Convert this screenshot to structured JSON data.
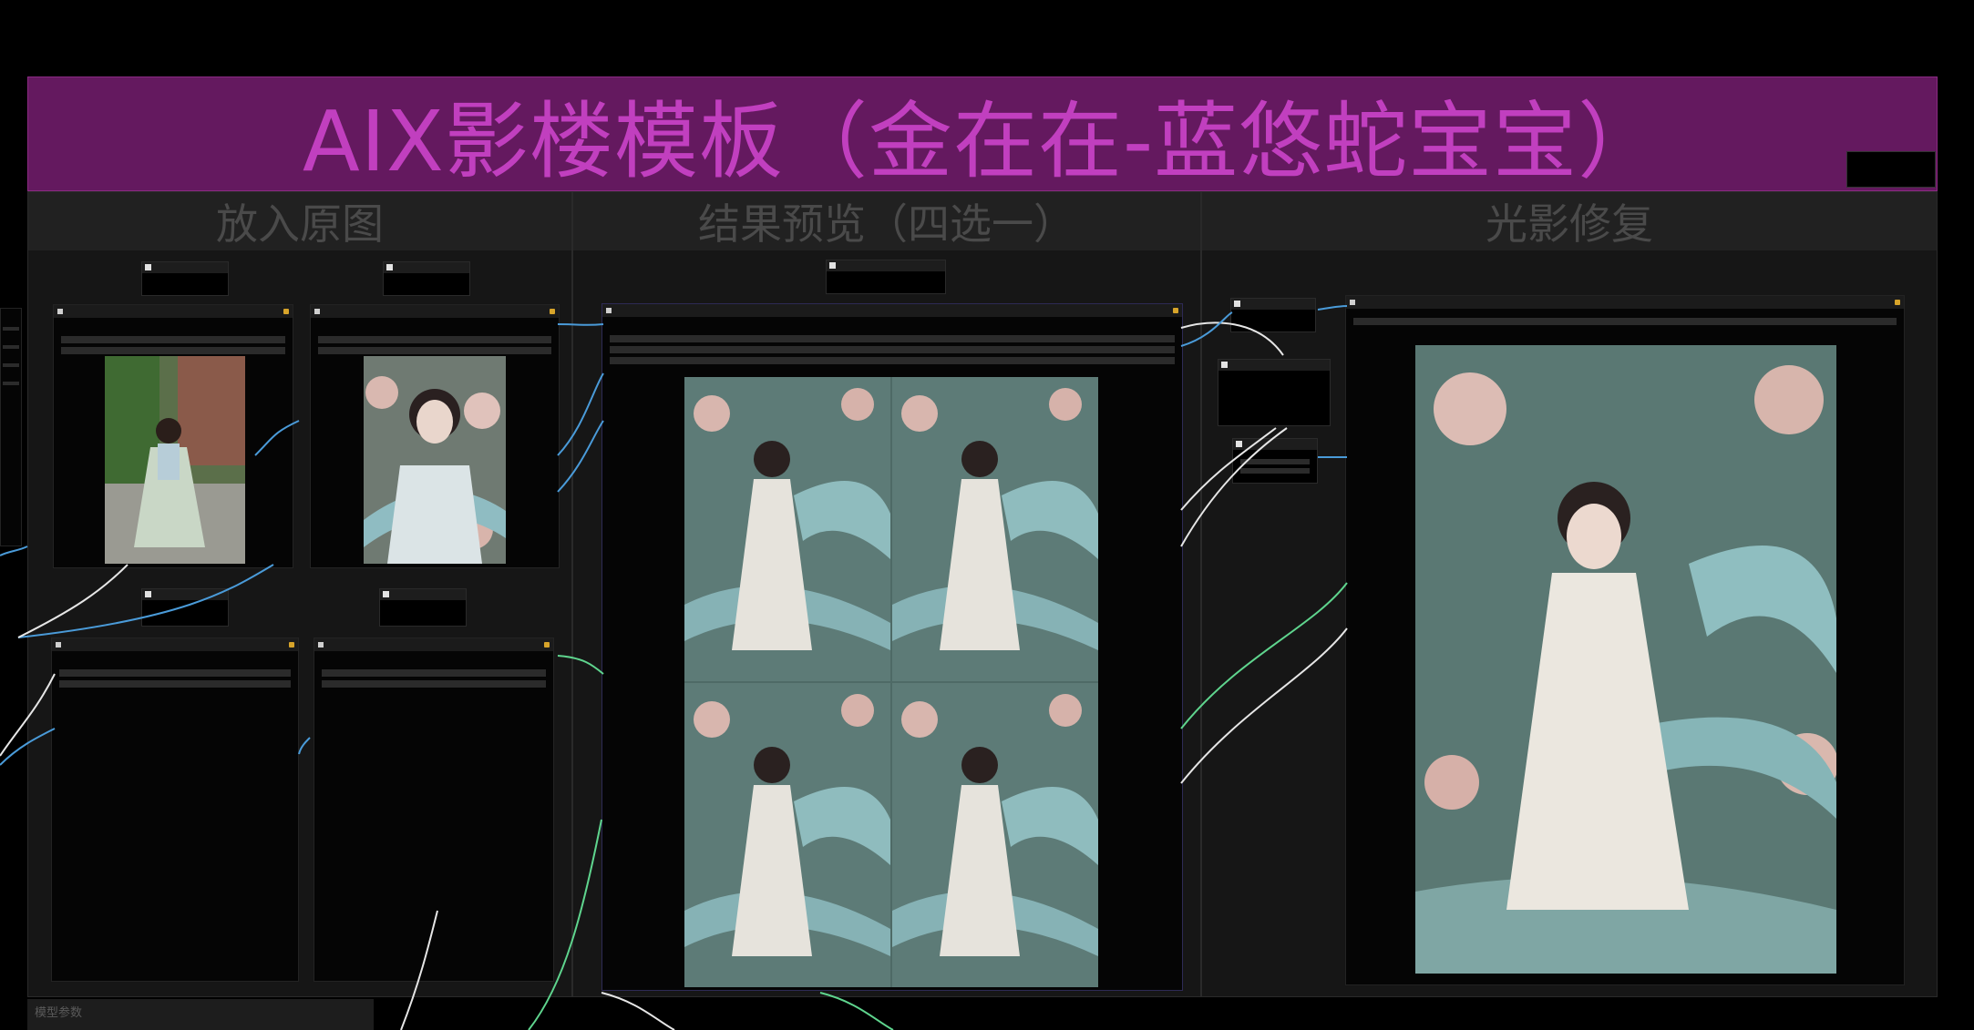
{
  "title": "AIX影楼模板（金在在-蓝悠蛇宝宝）",
  "groups": {
    "input": "放入原图",
    "preview": "结果预览（四选一）",
    "relight": "光影修复"
  },
  "bottom_label": "模型参数",
  "colors": {
    "title_bg": "#64195f",
    "title_text": "#c13fbf",
    "group_bg": "#161616",
    "group_header": "#212121",
    "wire_blue": "#4a9bd9",
    "wire_white": "#e6e6e6",
    "wire_green": "#5fd58e"
  }
}
